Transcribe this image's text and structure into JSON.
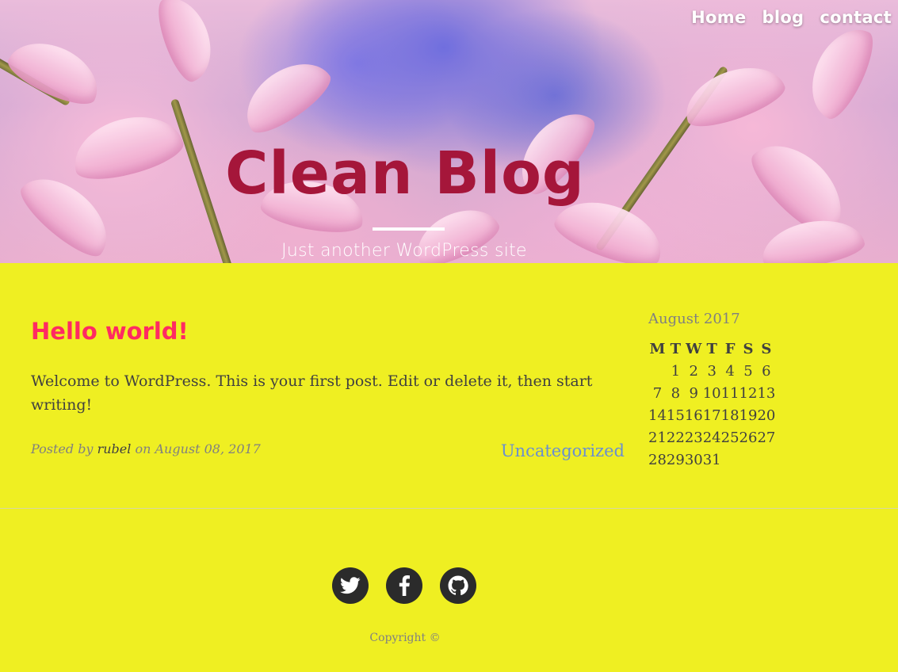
{
  "nav": {
    "items": [
      {
        "label": "Home"
      },
      {
        "label": "blog"
      },
      {
        "label": "contact"
      }
    ]
  },
  "header": {
    "title": "Clean Blog",
    "tagline": "Just another WordPress site"
  },
  "post": {
    "title": "Hello world!",
    "excerpt": "Welcome to WordPress. This is your first post. Edit or delete it, then start writing!",
    "meta_posted_by": "Posted by",
    "author": "rubel",
    "meta_on": "on",
    "date": "August 08, 2017",
    "category": "Uncategorized"
  },
  "calendar": {
    "caption": "August 2017",
    "weekdays": [
      "M",
      "T",
      "W",
      "T",
      "F",
      "S",
      "S"
    ],
    "weeks": [
      [
        "",
        "1",
        "2",
        "3",
        "4",
        "5",
        "6"
      ],
      [
        "7",
        "8",
        "9",
        "10",
        "11",
        "12",
        "13"
      ],
      [
        "14",
        "15",
        "16",
        "17",
        "18",
        "19",
        "20"
      ],
      [
        "21",
        "22",
        "23",
        "24",
        "25",
        "26",
        "27"
      ],
      [
        "28",
        "29",
        "30",
        "31",
        "",
        "",
        ""
      ]
    ]
  },
  "footer": {
    "social": [
      {
        "name": "twitter-icon"
      },
      {
        "name": "facebook-icon"
      },
      {
        "name": "github-icon"
      }
    ],
    "copyright": "Copyright ©"
  },
  "colors": {
    "page_background": "#efef22",
    "title": "#a5163a",
    "post_title": "#ff2a62",
    "category_link": "#6a8fd0"
  }
}
